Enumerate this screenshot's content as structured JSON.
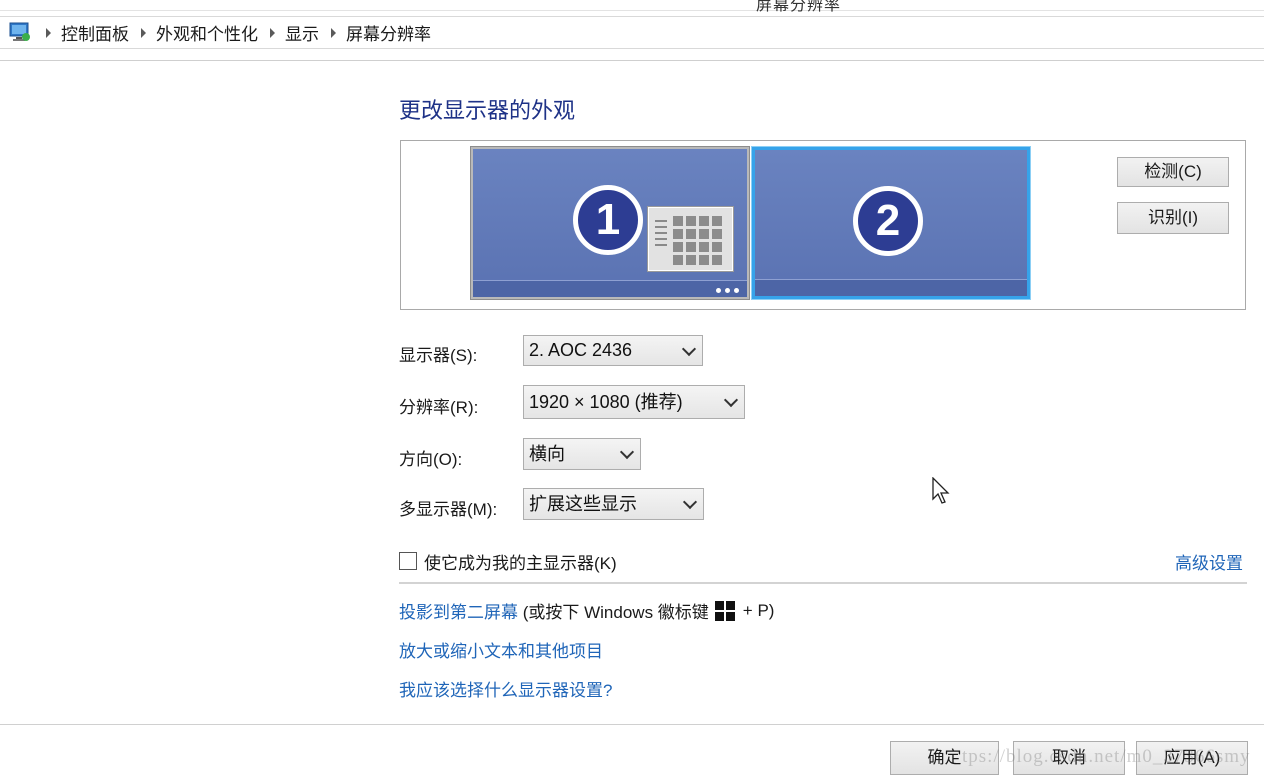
{
  "window": {
    "title_fragment": "屏幕分辨率"
  },
  "breadcrumb": {
    "icon": "control-panel-icon",
    "items": [
      "控制面板",
      "外观和个性化",
      "显示",
      "屏幕分辨率"
    ]
  },
  "main": {
    "title": "更改显示器的外观"
  },
  "monitors": [
    {
      "number": "1",
      "selected": false
    },
    {
      "number": "2",
      "selected": true
    }
  ],
  "buttons": {
    "detect": "检测(C)",
    "identify": "识别(I)"
  },
  "fields": {
    "display": {
      "label": "显示器(S):",
      "value": "2. AOC 2436"
    },
    "resolution": {
      "label": "分辨率(R):",
      "value": "1920 × 1080 (推荐)"
    },
    "orientation": {
      "label": "方向(O):",
      "value": "横向"
    },
    "multiple_displays": {
      "label": "多显示器(M):",
      "value": "扩展这些显示"
    }
  },
  "main_display_checkbox": {
    "label": "使它成为我的主显示器(K)",
    "checked": false
  },
  "links": {
    "advanced": "高级设置",
    "project": "投影到第二屏幕",
    "project_hint_prefix": " (或按下 Windows 徽标键",
    "project_hint_suffix": "+ P)",
    "text_size": "放大或缩小文本和其他项目",
    "which_settings": "我应该选择什么显示器设置?"
  },
  "footer": {
    "ok": "确定",
    "cancel": "取消",
    "apply": "应用(A)"
  },
  "watermark": "tps://blog.csdn.net/m0_37366smy",
  "colors": {
    "link": "#1f65b8",
    "title": "#1e3287",
    "selected_border": "#36a3ea",
    "monitor_fill": "#5a72b2"
  }
}
